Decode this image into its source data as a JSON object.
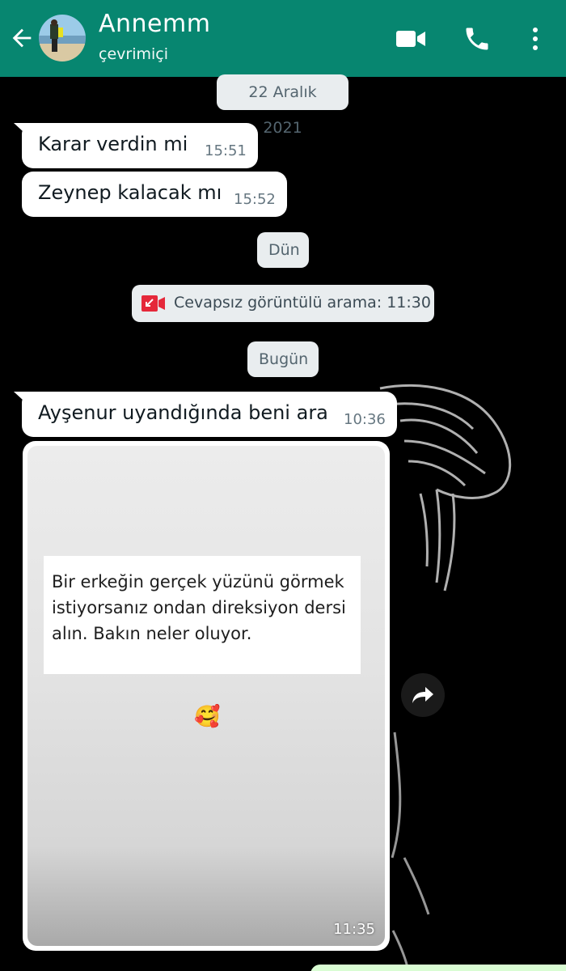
{
  "header": {
    "contact_name": "Annemm",
    "status": "çevrimiçi",
    "color": "#078670"
  },
  "icons": {
    "back": "arrow-left-icon",
    "video": "video-camera-icon",
    "phone": "phone-icon",
    "menu": "more-vertical-icon",
    "forward": "forward-arrow-icon",
    "missed_video": "missed-video-call-icon"
  },
  "chat": {
    "date_1": "22 Aralık 2021",
    "msg_1": {
      "text": "Karar verdin mi",
      "time": "15:51"
    },
    "msg_2": {
      "text": "Zeynep kalacak mı",
      "time": "15:52"
    },
    "date_2": "Dün",
    "missed_call": "Cevapsız görüntülü arama: 11:30",
    "date_3": "Bugün",
    "msg_3": {
      "text": "Ayşenur uyandığında beni ara",
      "time": "10:36"
    },
    "image_msg": {
      "quote_line_1": "Bir erkeğin gerçek yüzünü görmek",
      "quote_line_2": "istiyorsanız ondan direksiyon dersi",
      "quote_line_3": "alın. Bakın neler oluyor.",
      "emoji": "🥰",
      "time": "11:35"
    }
  },
  "colors": {
    "incoming_bubble": "#ffffff",
    "outgoing_bubble": "#d9fdd3",
    "system_pill": "#e9edef",
    "missed_call_red": "#e5283a"
  }
}
